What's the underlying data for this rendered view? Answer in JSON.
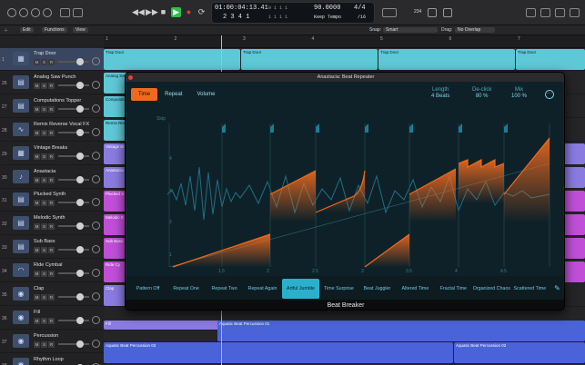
{
  "transport": {
    "time": "01:00:04:13.41",
    "bars": "2 3 4 1",
    "sub_top": "9  1  1  1",
    "sub_bot": "1  1  1  1",
    "tempo": "90.0000",
    "tempo_mode": "Keep Tempo",
    "signature": "4/4",
    "division": "/16",
    "cpu": "234"
  },
  "toolbar": {
    "edit": "Edit",
    "functions": "Functions",
    "view": "View",
    "snap_label": "Snap:",
    "snap_value": "Smart",
    "drag_label": "Drag:",
    "drag_value": "No Overlap"
  },
  "ruler": [
    "1",
    "2",
    "3",
    "4",
    "5",
    "6",
    "7",
    "8"
  ],
  "tracks": [
    {
      "num": "1",
      "name": "Trap Door",
      "icon": "drum-machine-icon"
    },
    {
      "num": "26",
      "name": "Analog Saw Punch",
      "icon": "keyboard-icon"
    },
    {
      "num": "27",
      "name": "Computations Topper",
      "icon": "keyboard-icon"
    },
    {
      "num": "28",
      "name": "Remix Reverse Vocal FX",
      "icon": "waveform-icon"
    },
    {
      "num": "29",
      "name": "Vintage Breaks",
      "icon": "drum-machine-icon"
    },
    {
      "num": "30",
      "name": "Anastacia",
      "icon": "microphone-icon"
    },
    {
      "num": "31",
      "name": "Plucked Synth",
      "icon": "keyboard-icon"
    },
    {
      "num": "32",
      "name": "Melodic Synth",
      "icon": "keyboard-icon"
    },
    {
      "num": "33",
      "name": "Sub Bass",
      "icon": "keyboard-icon"
    },
    {
      "num": "34",
      "name": "Ride Cymbal",
      "icon": "cymbal-icon"
    },
    {
      "num": "35",
      "name": "Clap",
      "icon": "drum-pad-icon"
    },
    {
      "num": "36",
      "name": "Fill",
      "icon": "drum-pad-icon"
    },
    {
      "num": "37",
      "name": "Percussion",
      "icon": "drum-pad-icon"
    },
    {
      "num": "38",
      "name": "Rhythm Loop",
      "icon": "drum-pad-icon"
    }
  ],
  "regions": {
    "trap": "Trap Door",
    "computations": "Computations T",
    "remix": "Remix Reve",
    "vintage": "Vintage Br",
    "anastacia": "Anastacia",
    "plucked": "Plucked S",
    "melodic": "Melodic S",
    "sub": "Sub Bass",
    "ride": "Ride Cy",
    "clap": "Clap",
    "fill": "Fill",
    "perc": "Aquatic Beat Percussion 01",
    "rhythm1": "Aquatic Beat Percussion 02",
    "rhythm2": "Aquatic Beat Percussion 02",
    "track2": "Analog Saw"
  },
  "plugin": {
    "window_title": "Anastacia: Beat Repeater",
    "tabs": [
      "Time",
      "Repeat",
      "Volume"
    ],
    "length_label": "Length",
    "length_value": "4 Beats",
    "declick_label": "De-click",
    "declick_value": "80 %",
    "mix_label": "Mix",
    "mix_value": "100 %",
    "skip_label": "Skip",
    "y_nums": [
      "4",
      "3",
      "2",
      "1"
    ],
    "x_nums": [
      "1.5",
      "2",
      "2.5",
      "3",
      "3.5",
      "4",
      "4.5"
    ],
    "patterns": [
      "Pattern Off",
      "Repeat One",
      "Repeat Two",
      "Repeat Again",
      "Artful Jumble",
      "Time Surprise",
      "Beat Juggler",
      "Altered Time",
      "Fractal Time",
      "Organized Chaos",
      "Scattered Time"
    ],
    "selected_pattern": "Artful Jumble",
    "name": "Beat Breaker"
  },
  "colors": {
    "accent": "#f06a1e",
    "teal_region": "#5ec8d6",
    "selected_pattern": "#2ab0cc",
    "play": "#2fbf4a"
  }
}
